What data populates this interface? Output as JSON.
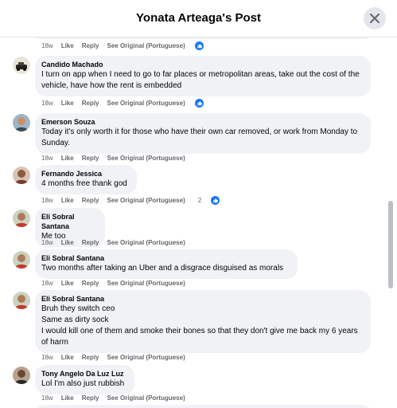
{
  "header": {
    "title": "Yonata Arteaga's Post"
  },
  "actions": {
    "like": "Like",
    "reply": "Reply",
    "see_original": "See Original (Portuguese)"
  },
  "comments": [
    {
      "author": "",
      "text": "",
      "time": "18w",
      "reactions": ""
    },
    {
      "author": "Candido Machado",
      "text": "I turn on app when I need to go to far places or metropolitan areas, take out the cost of the vehicle, have how the rent is embedded",
      "time": "18w",
      "reactions": ""
    },
    {
      "author": "Emerson Souza",
      "text": "Today it's only worth it for those who have their own car removed, or work from Monday to Sunday.",
      "time": "18w",
      "reactions": ""
    },
    {
      "author": "Fernando Jessica",
      "text": "4 months free thank god",
      "time": "18w",
      "reactions": "2"
    },
    {
      "author": "Eli Sobral Santana",
      "text": "Me too",
      "time": "18w",
      "reactions": ""
    },
    {
      "author": "Eli Sobral Santana",
      "text": "Two months after taking an Uber and a disgrace disguised as morals",
      "time": "18w",
      "reactions": ""
    },
    {
      "author": "Eli Sobral Santana",
      "text": "Bruh they switch ceo\nSame as dirty sock\nI would kill one of them and smoke their bones so that they don't give me back my 6 years of harm",
      "time": "18w",
      "reactions": ""
    },
    {
      "author": "Tony Angelo Da Luz Luz",
      "text": "Lol I'm also just rubbish",
      "time": "18w",
      "reactions": ""
    }
  ]
}
